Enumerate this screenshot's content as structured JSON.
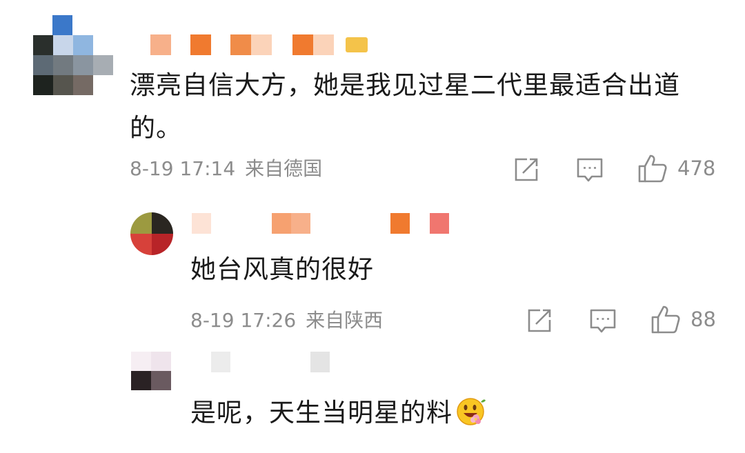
{
  "comments": [
    {
      "text": "漂亮自信大方，她是我见过星二代里最适合出道的。",
      "date": "8-19 17:14",
      "location": "来自德国",
      "likes": "478",
      "icons": {
        "share": "share-icon",
        "reply": "comment-icon",
        "like": "thumbs-up-icon"
      }
    },
    {
      "text": "她台风真的很好",
      "date": "8-19 17:26",
      "location": "来自陕西",
      "likes": "88",
      "icons": {
        "share": "share-icon",
        "reply": "comment-icon",
        "like": "thumbs-up-icon"
      }
    },
    {
      "text": "是呢，天生当明星的料",
      "emoji": "smiling-face-with-flower-emoji"
    }
  ],
  "colors": {
    "text": "#1a1a1a",
    "meta": "#8c8c8c",
    "username_blur": "#f07a2f"
  }
}
